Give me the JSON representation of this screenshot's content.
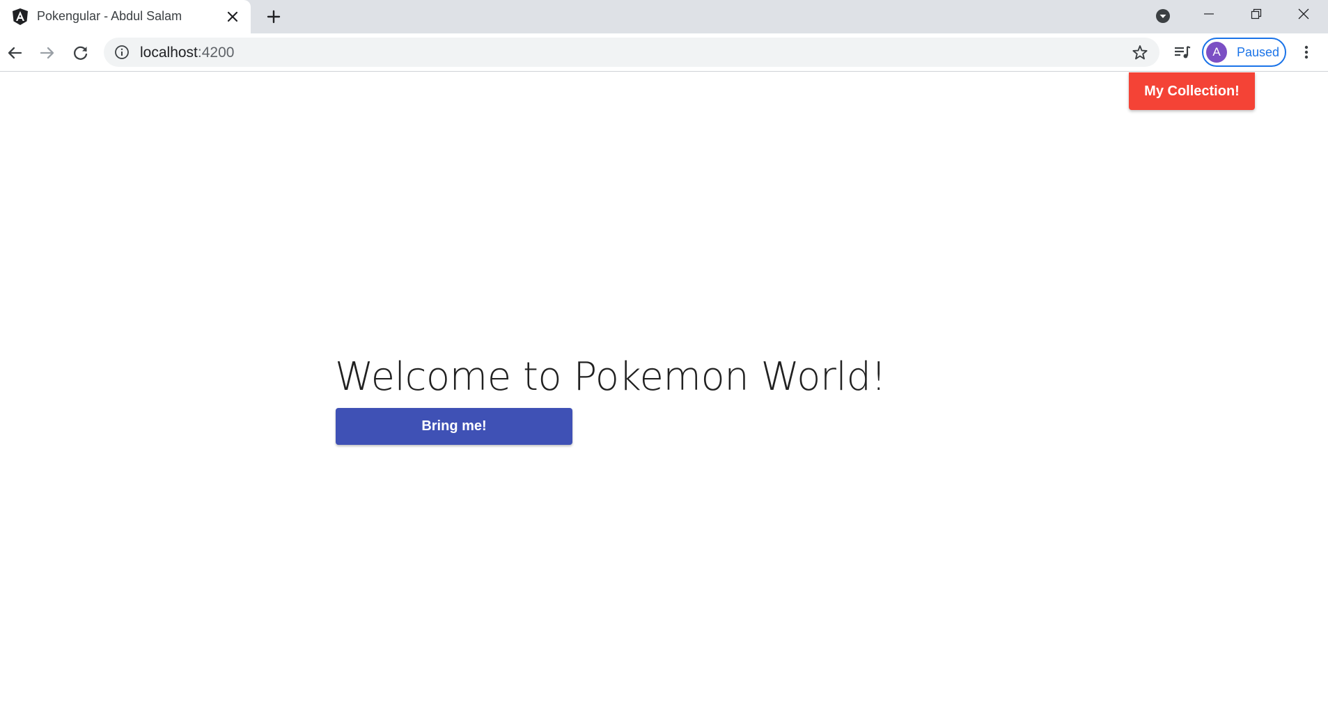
{
  "browser": {
    "tab": {
      "title": "Pokengular - Abdul Salam",
      "favicon": "angular-icon"
    },
    "toolbar": {
      "url_host": "localhost",
      "url_port": ":4200",
      "profile": {
        "initial": "A",
        "status": "Paused",
        "avatar_color": "#7b4fc4",
        "accent_color": "#1a73e8"
      }
    }
  },
  "page": {
    "collection_button": {
      "label": "My Collection!",
      "color": "#f44336"
    },
    "welcome_title": "Welcome to Pokemon World!",
    "bring_button": {
      "label": "Bring me!",
      "color": "#3f51b5"
    }
  }
}
